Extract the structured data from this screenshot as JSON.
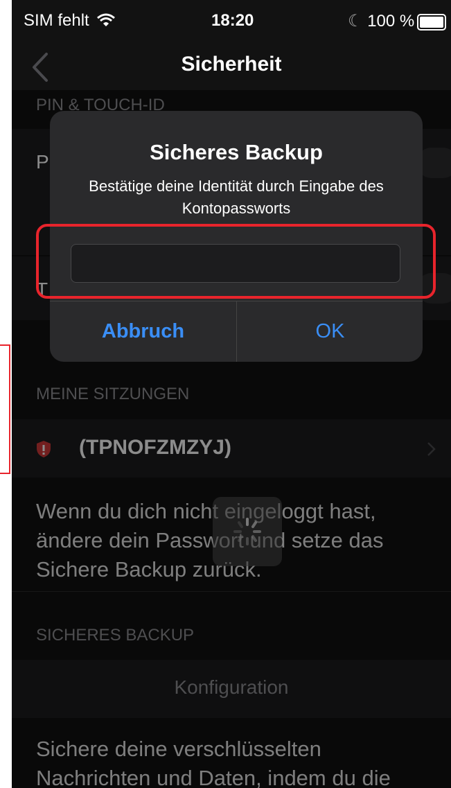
{
  "status": {
    "carrier": "SIM fehlt",
    "time": "18:20",
    "battery": "100 %"
  },
  "nav": {
    "title": "Sicherheit"
  },
  "sections": {
    "pin_header": "PIN & TOUCH-ID",
    "pin_row_label": "P",
    "touch_row_label": "T",
    "sessions_header": "MEINE SITZUNGEN",
    "session_name": "(TPNOFZMZYJ)",
    "session_desc": "Wenn du dich nicht eingeloggt hast, ändere dein Passwort und setze das Sichere Backup zurück.",
    "backup_header": "SICHERES BACKUP",
    "backup_config": "Konfiguration",
    "backup_desc": "Sichere deine verschlüsselten Nachrichten und Daten, indem du die"
  },
  "alert": {
    "title": "Sicheres Backup",
    "message": "Bestätige deine Identität durch Eingabe des Kontopassworts",
    "input_value": "",
    "cancel_label": "Abbruch",
    "ok_label": "OK"
  },
  "colors": {
    "accent": "#3a8ef6",
    "highlight": "#e8242c",
    "shield": "#d03a3a"
  }
}
